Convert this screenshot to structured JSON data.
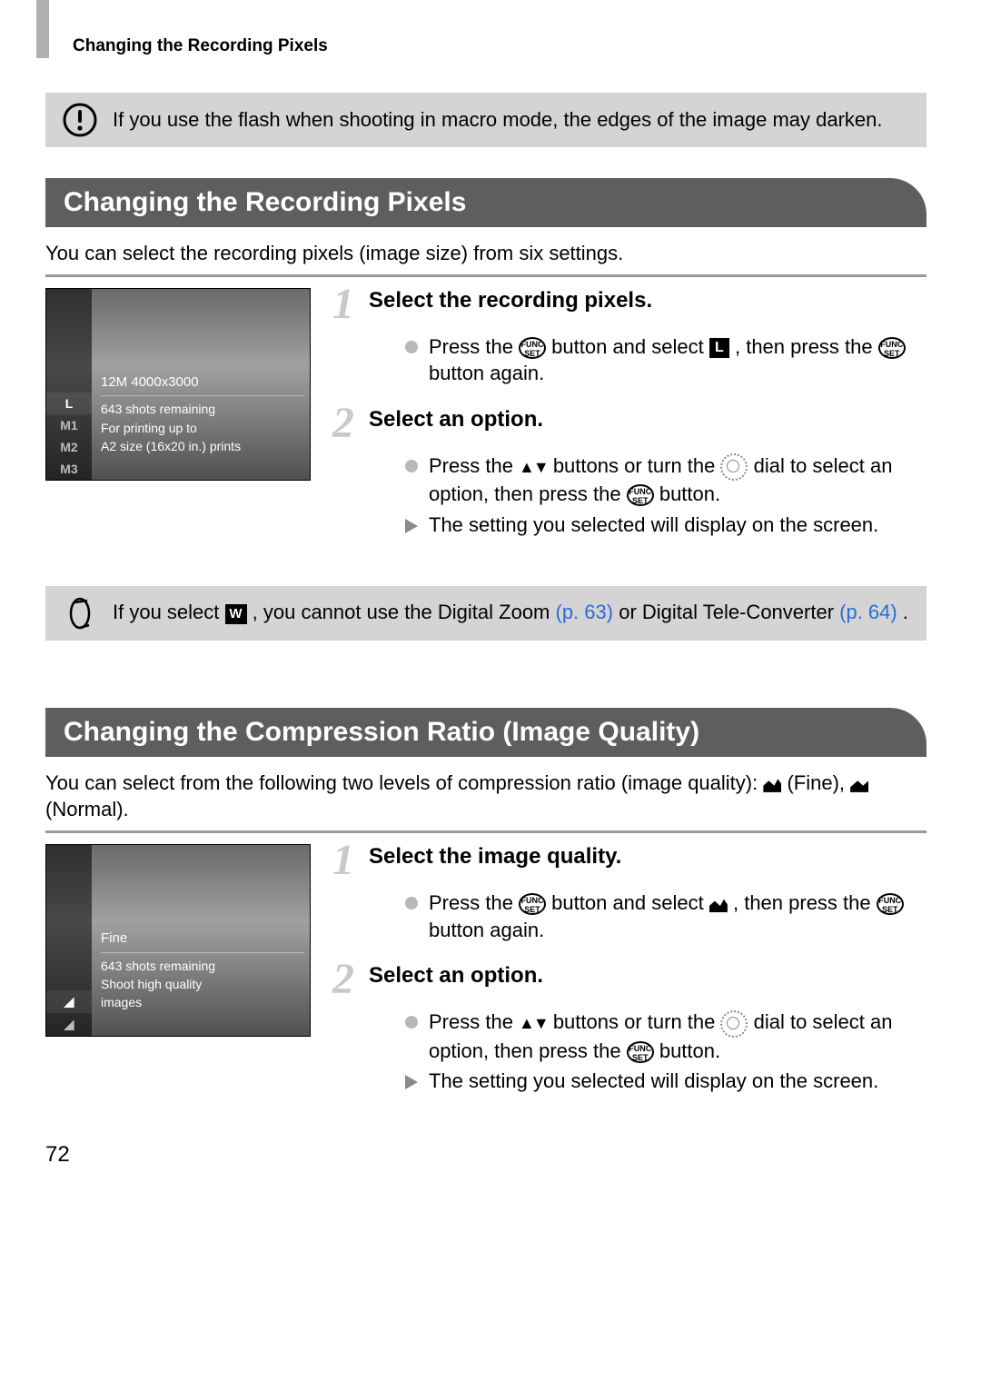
{
  "running_head": "Changing the Recording Pixels",
  "warning_box": {
    "text": "If you use the flash when shooting in macro mode, the edges of the image may darken."
  },
  "section1": {
    "heading": "Changing the Recording Pixels",
    "intro": "You can select the recording pixels (image size) from six settings.",
    "lcd": {
      "sidebar": [
        "L",
        "M1",
        "M2",
        "M3"
      ],
      "title": "12M 4000x3000",
      "line1": "643 shots remaining",
      "line2": "For printing up to",
      "line3": "A2 size (16x20 in.) prints"
    },
    "step1": {
      "title": "Select the recording pixels.",
      "body_a": "Press the ",
      "body_b": " button and select ",
      "body_c": " , then press the ",
      "body_d": " button again."
    },
    "step2": {
      "title": "Select an option.",
      "body_a": "Press the ",
      "body_b": " buttons or turn the ",
      "body_c": " dial to select an option, then press the ",
      "body_d": " button.",
      "result": "The setting you selected will display on the screen."
    }
  },
  "note_box": {
    "pre": "If you select ",
    "mid": ", you cannot use the Digital Zoom ",
    "link1": "(p. 63)",
    "mid2": " or Digital Tele-Converter ",
    "link2": "(p. 64)",
    "post": "."
  },
  "section2": {
    "heading": "Changing the Compression Ratio (Image Quality)",
    "intro_a": "You can select from the following two levels of compression ratio (image quality): ",
    "fine_label": " (Fine), ",
    "normal_label": " (Normal).",
    "lcd": {
      "title": "Fine",
      "line1": "643 shots remaining",
      "line2": "Shoot high quality",
      "line3": "images"
    },
    "step1": {
      "title": "Select the image quality.",
      "body_a": "Press the ",
      "body_b": " button and select ",
      "body_c": " , then press the ",
      "body_d": " button again."
    },
    "step2": {
      "title": "Select an option.",
      "body_a": "Press the ",
      "body_b": " buttons or turn the ",
      "body_c": " dial to select an option, then press the ",
      "body_d": " button.",
      "result": "The setting you selected will display on the screen."
    }
  },
  "page_number": "72"
}
